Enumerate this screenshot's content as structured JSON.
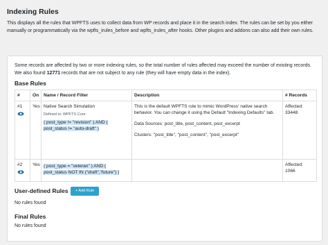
{
  "page": {
    "title": "Indexing Rules",
    "intro": "This displays all the rules that WPFTS uses to collect data from WP records and place it in the search index. The rules can be set by you either manually or programmatically via the wpfts_irules_before and wpfts_irules_after hooks. Other plugins and addons can also add their own rules."
  },
  "panel": {
    "note_before": "Some records are affected by two or more indexing rules, so the total number of rules affected may exceed the number of existing records. We also found ",
    "note_count": "12771",
    "note_after": " records that are not subject to any rule (they will have empty data in the index)."
  },
  "base_rules": {
    "heading": "Base Rules",
    "columns": [
      "#",
      "On",
      "Name / Record Filter",
      "Description",
      "# Records"
    ],
    "rows": [
      {
        "num": "#1",
        "on": "Yes",
        "name": "Native Search Simulation",
        "defined": "Defined in: WPFTS Core",
        "expr_line1": "( post_type != \"revision\" ) AND (",
        "expr_line2": "post_status != \"auto-draft\" )",
        "desc1": "This is the default WPFTS rule to mimic WordPress' native search behavior. You can change it using the Default \"Indexing Defaults\" tab.",
        "desc2": "Data Sources: post_title, post_content, post_excerpt",
        "desc3": "Clusters: \"post_title\", \"post_content\", \"post_excerpt\"",
        "affected_label": "Affected:",
        "affected": "33448"
      },
      {
        "num": "#2",
        "on": "Yes",
        "expr_line1": "( post_type = \"veteran\" ) AND (",
        "expr_line2": "post_status NOT IN (\"draft\",\"future\") )",
        "affected_label": "Affected:",
        "affected": "1066"
      }
    ]
  },
  "user_rules": {
    "heading": "User-defined Rules",
    "add_button": "+ Add Rule",
    "empty": "No rules found"
  },
  "final_rules": {
    "heading": "Final Rules",
    "empty": "No rules found"
  },
  "colors": {
    "accent": "#2ea2cc",
    "highlight": "#cfe3f7",
    "eye": "#2271b1"
  },
  "icons": [
    "eye-icon"
  ]
}
